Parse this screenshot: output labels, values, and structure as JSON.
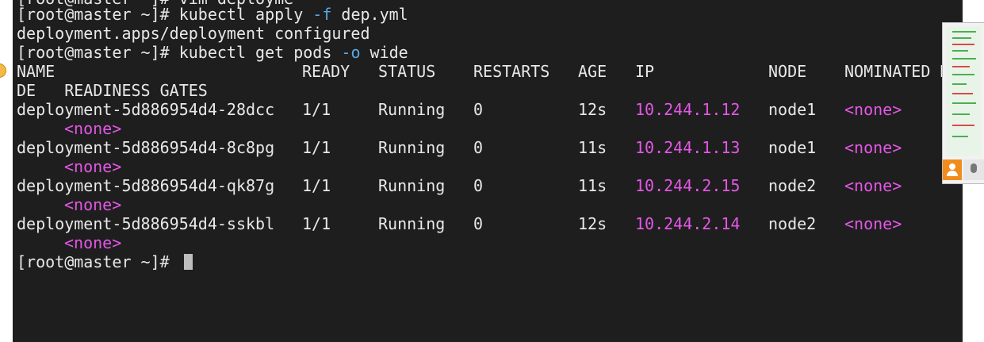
{
  "terminal": {
    "partial_top_line": "[root@master ~]# vim deployme",
    "cmd1_prompt": "[root@master ~]# ",
    "cmd1_cmd": "kubectl apply ",
    "cmd1_flag": "-f",
    "cmd1_arg": " dep.yml",
    "output1": "deployment.apps/deployment configured",
    "cmd2_prompt": "[root@master ~]# ",
    "cmd2_cmd": "kubectl get pods ",
    "cmd2_flag": "-o",
    "cmd2_arg": " wide",
    "headers": {
      "name": "NAME",
      "ready": "READY",
      "status": "STATUS",
      "restarts": "RESTARTS",
      "age": "AGE",
      "ip": "IP",
      "node": "NODE",
      "nominated": "NOMINATED N",
      "wrap": "DE   READINESS GATES"
    },
    "rows": [
      {
        "name": "deployment-5d886954d4-28dcc",
        "ready": "1/1",
        "status": "Running",
        "restarts": "0",
        "age": "12s",
        "ip": "10.244.1.12",
        "node": "node1",
        "nominated": "<none>",
        "gates": "<none>"
      },
      {
        "name": "deployment-5d886954d4-8c8pg",
        "ready": "1/1",
        "status": "Running",
        "restarts": "0",
        "age": "11s",
        "ip": "10.244.1.13",
        "node": "node1",
        "nominated": "<none>",
        "gates": "<none>"
      },
      {
        "name": "deployment-5d886954d4-qk87g",
        "ready": "1/1",
        "status": "Running",
        "restarts": "0",
        "age": "11s",
        "ip": "10.244.2.15",
        "node": "node2",
        "nominated": "<none>",
        "gates": "<none>"
      },
      {
        "name": "deployment-5d886954d4-sskbl",
        "ready": "1/1",
        "status": "Running",
        "restarts": "0",
        "age": "12s",
        "ip": "10.244.2.14",
        "node": "node2",
        "nominated": "<none>",
        "gates": "<none>"
      }
    ],
    "final_prompt": "[root@master ~]# "
  },
  "colors": {
    "background": "#1e1e1e",
    "text": "#e8e8e8",
    "flag": "#5aa9e6",
    "ip": "#e457e6"
  },
  "icons": {
    "left_edge": "app-icon",
    "right_user": "user-icon",
    "right_mic": "microphone-icon"
  }
}
